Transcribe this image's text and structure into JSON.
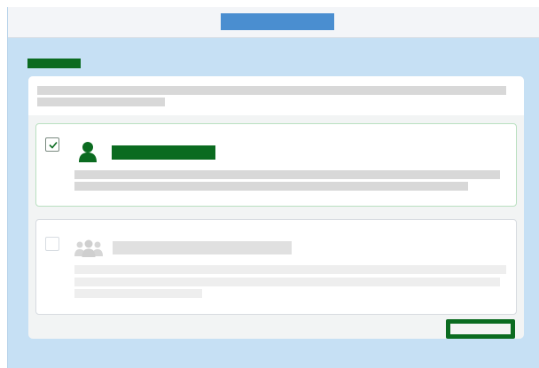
{
  "topbar": {
    "title": ""
  },
  "section": {
    "heading": ""
  },
  "intro": {
    "line1": "",
    "line2": ""
  },
  "options": [
    {
      "title": "",
      "description_line1": "",
      "description_line2": "",
      "checked": true,
      "icon": "single-user-icon"
    },
    {
      "title": "",
      "description_line1": "",
      "description_line2": "",
      "description_line3": "",
      "checked": false,
      "icon": "group-users-icon"
    }
  ],
  "footer": {
    "primary_label": ""
  },
  "colors": {
    "accent": "#0b6b20",
    "selected_border": "#b9e0c0",
    "topbar_title": "#4a8ed0",
    "page_background": "#c6e0f4"
  }
}
